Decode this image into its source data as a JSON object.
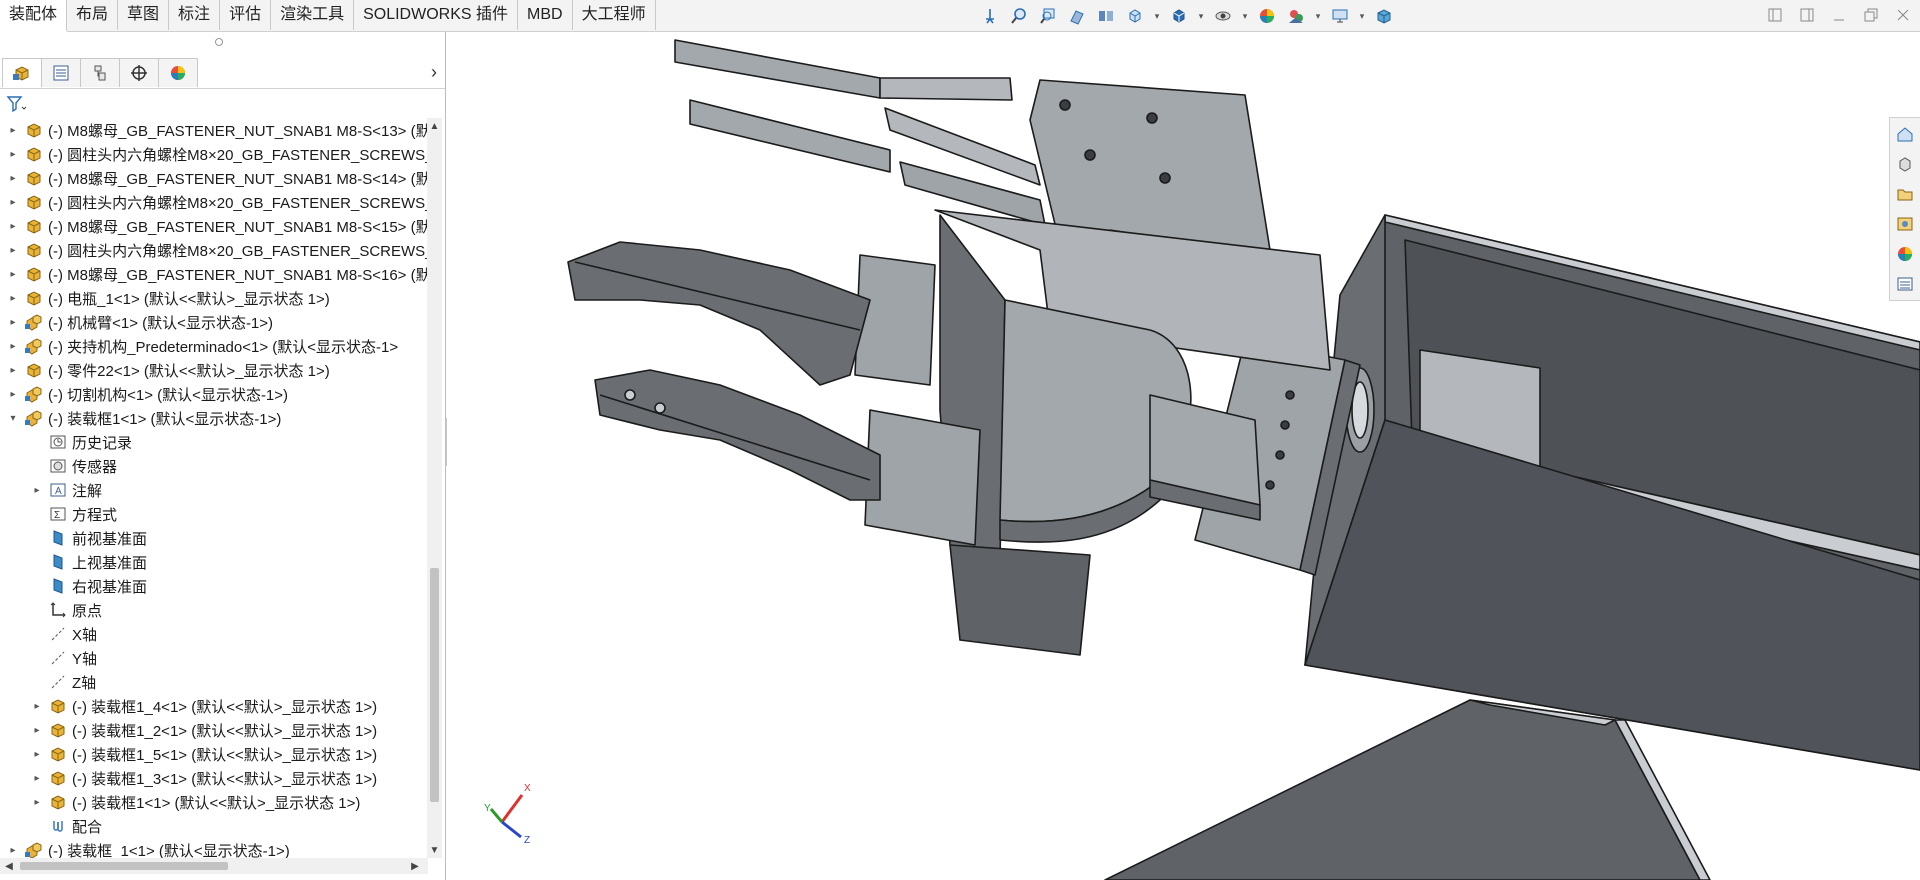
{
  "ribbon_tabs": [
    "装配体",
    "布局",
    "草图",
    "标注",
    "评估",
    "渲染工具",
    "SOLIDWORKS 插件",
    "MBD",
    "大工程师"
  ],
  "active_tab_index": 0,
  "heads_up_toolbar_icons": [
    "zoom-to-fit-icon",
    "zoom-area-icon",
    "previous-view-icon",
    "section-view-icon",
    "dynamic-annotation-icon",
    "view-orientation-icon",
    "display-style-icon",
    "hide-show-icon",
    "edit-appearance-icon",
    "apply-scene-icon",
    "view-settings-icon",
    "3d-view-icon"
  ],
  "panel_tabs": [
    "featuremanager-tab",
    "propertymanager-tab",
    "configurationmanager-tab",
    "dimxpert-tab",
    "displaymanager-tab"
  ],
  "tree": [
    {
      "label": "(-) M8螺母_GB_FASTENER_NUT_SNAB1 M8-S<13> (默",
      "icon": "part",
      "level": 0,
      "expander": "collapsed"
    },
    {
      "label": "(-) 圆柱头内六角螺栓M8×20_GB_FASTENER_SCREWS_",
      "icon": "part",
      "level": 0,
      "expander": "collapsed"
    },
    {
      "label": "(-) M8螺母_GB_FASTENER_NUT_SNAB1 M8-S<14> (默",
      "icon": "part",
      "level": 0,
      "expander": "collapsed"
    },
    {
      "label": "(-) 圆柱头内六角螺栓M8×20_GB_FASTENER_SCREWS_",
      "icon": "part",
      "level": 0,
      "expander": "collapsed"
    },
    {
      "label": "(-) M8螺母_GB_FASTENER_NUT_SNAB1 M8-S<15> (默",
      "icon": "part",
      "level": 0,
      "expander": "collapsed"
    },
    {
      "label": "(-) 圆柱头内六角螺栓M8×20_GB_FASTENER_SCREWS_",
      "icon": "part",
      "level": 0,
      "expander": "collapsed"
    },
    {
      "label": "(-) M8螺母_GB_FASTENER_NUT_SNAB1 M8-S<16> (默",
      "icon": "part",
      "level": 0,
      "expander": "collapsed"
    },
    {
      "label": "(-) 电瓶_1<1> (默认<<默认>_显示状态 1>)",
      "icon": "part",
      "level": 0,
      "expander": "collapsed"
    },
    {
      "label": "(-) 机械臂<1> (默认<显示状态-1>)",
      "icon": "assembly",
      "level": 0,
      "expander": "collapsed"
    },
    {
      "label": "(-) 夹持机构_Predeterminado<1> (默认<显示状态-1>",
      "icon": "assembly",
      "level": 0,
      "expander": "collapsed"
    },
    {
      "label": "(-) 零件22<1> (默认<<默认>_显示状态 1>)",
      "icon": "part",
      "level": 0,
      "expander": "collapsed"
    },
    {
      "label": "(-) 切割机构<1> (默认<显示状态-1>)",
      "icon": "assembly",
      "level": 0,
      "expander": "collapsed"
    },
    {
      "label": "(-) 装载框1<1> (默认<显示状态-1>)",
      "icon": "assembly",
      "level": 0,
      "expander": "expanded"
    },
    {
      "label": "历史记录",
      "icon": "history",
      "level": 1,
      "expander": "none"
    },
    {
      "label": "传感器",
      "icon": "sensor",
      "level": 1,
      "expander": "none"
    },
    {
      "label": "注解",
      "icon": "annotation",
      "level": 1,
      "expander": "collapsed"
    },
    {
      "label": "方程式",
      "icon": "equation",
      "level": 1,
      "expander": "none"
    },
    {
      "label": "前视基准面",
      "icon": "plane",
      "level": 1,
      "expander": "none"
    },
    {
      "label": "上视基准面",
      "icon": "plane",
      "level": 1,
      "expander": "none"
    },
    {
      "label": "右视基准面",
      "icon": "plane",
      "level": 1,
      "expander": "none"
    },
    {
      "label": "原点",
      "icon": "origin",
      "level": 1,
      "expander": "none"
    },
    {
      "label": "X轴",
      "icon": "axis",
      "level": 1,
      "expander": "none"
    },
    {
      "label": "Y轴",
      "icon": "axis",
      "level": 1,
      "expander": "none"
    },
    {
      "label": "Z轴",
      "icon": "axis",
      "level": 1,
      "expander": "none"
    },
    {
      "label": "(-) 装载框1_4<1> (默认<<默认>_显示状态 1>)",
      "icon": "part",
      "level": 1,
      "expander": "collapsed"
    },
    {
      "label": "(-) 装载框1_2<1> (默认<<默认>_显示状态 1>)",
      "icon": "part",
      "level": 1,
      "expander": "collapsed"
    },
    {
      "label": "(-) 装载框1_5<1> (默认<<默认>_显示状态 1>)",
      "icon": "part",
      "level": 1,
      "expander": "collapsed"
    },
    {
      "label": "(-) 装载框1_3<1> (默认<<默认>_显示状态 1>)",
      "icon": "part",
      "level": 1,
      "expander": "collapsed"
    },
    {
      "label": "(-) 装载框1<1> (默认<<默认>_显示状态 1>)",
      "icon": "part",
      "level": 1,
      "expander": "collapsed"
    },
    {
      "label": "配合",
      "icon": "mates",
      "level": 1,
      "expander": "none"
    },
    {
      "label": "(-) 装载框_1<1> (默认<显示状态-1>)",
      "icon": "assembly",
      "level": 0,
      "expander": "collapsed"
    }
  ],
  "triad": {
    "x": "X",
    "y": "Y",
    "z": "Z"
  },
  "task_pane_icons": [
    "home-icon",
    "design-library-icon",
    "file-explorer-icon",
    "view-palette-icon",
    "appearances-icon",
    "custom-properties-icon"
  ],
  "colors": {
    "part_icon": "#e8b33a",
    "assembly_icon": "#e8b33a",
    "model_face": "#9fa4a8",
    "model_dark": "#5e6268",
    "x_axis": "#e03030",
    "y_axis": "#2a9a2a",
    "z_axis": "#2b45c8"
  }
}
